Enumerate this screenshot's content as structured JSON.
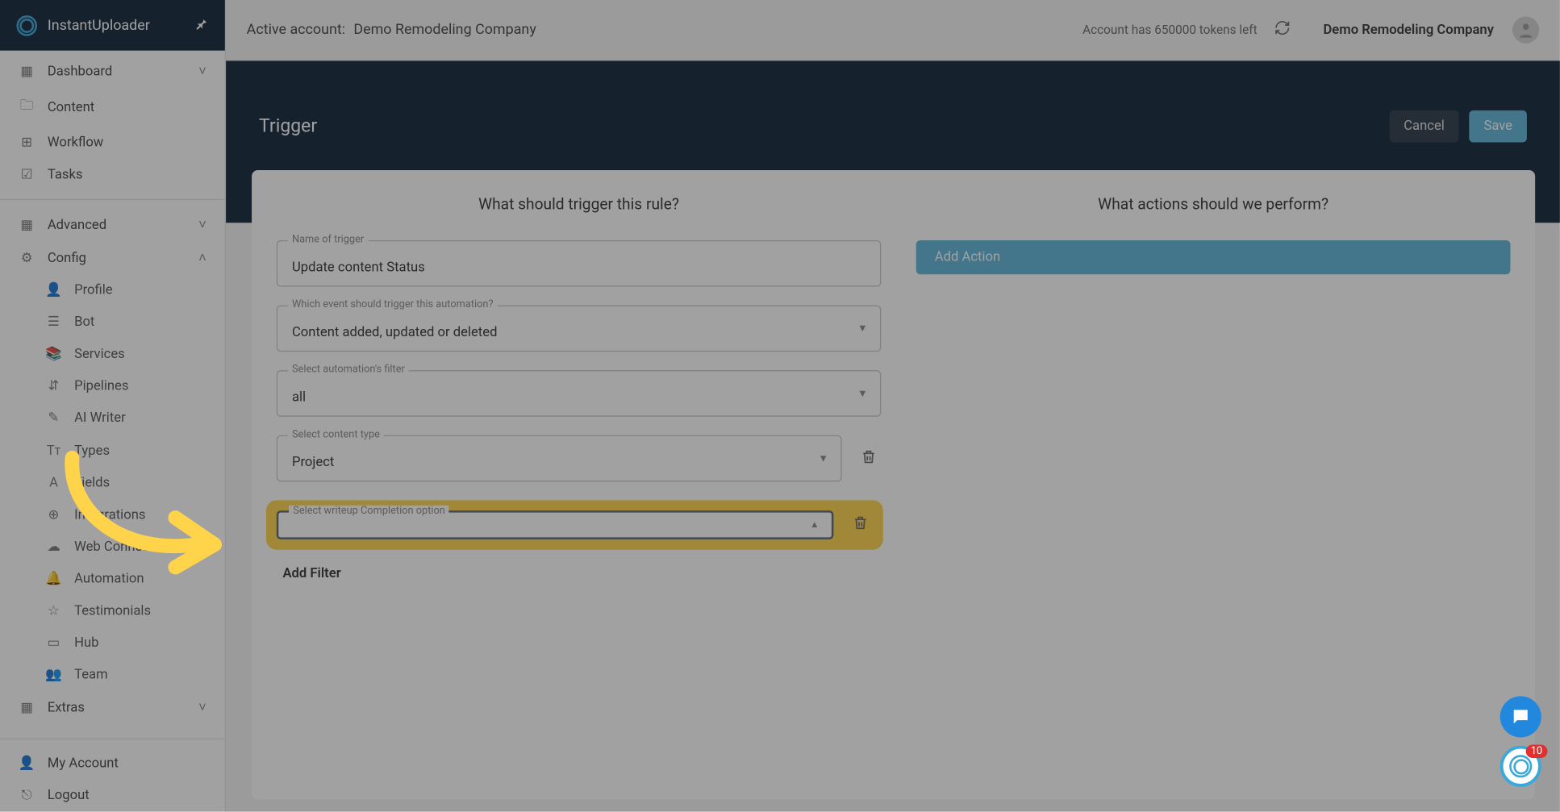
{
  "brand": "InstantUploader",
  "topbar": {
    "active_account_prefix": "Active account:",
    "active_account_name": "Demo Remodeling Company",
    "tokens_text": "Account has 650000 tokens left",
    "company": "Demo Remodeling Company"
  },
  "sidebar": {
    "items": [
      {
        "label": "Dashboard",
        "glyph": "▦",
        "chev": "˅"
      },
      {
        "label": "Content",
        "glyph": "🗀"
      },
      {
        "label": "Workflow",
        "glyph": "⊞"
      },
      {
        "label": "Tasks",
        "glyph": "☑"
      }
    ],
    "group2": [
      {
        "label": "Advanced",
        "glyph": "▦",
        "chev": "˅"
      },
      {
        "label": "Config",
        "glyph": "⚙",
        "chev": "˄"
      }
    ],
    "config_sub": [
      {
        "label": "Profile",
        "glyph": "👤"
      },
      {
        "label": "Bot",
        "glyph": "☰"
      },
      {
        "label": "Services",
        "glyph": "📚"
      },
      {
        "label": "Pipelines",
        "glyph": "⇵"
      },
      {
        "label": "AI Writer",
        "glyph": "✎"
      },
      {
        "label": "Types",
        "glyph": "Tᴛ"
      },
      {
        "label": "Fields",
        "glyph": "A"
      },
      {
        "label": "Integrations",
        "glyph": "⊕"
      },
      {
        "label": "Web Connect",
        "glyph": "☁"
      },
      {
        "label": "Automation",
        "glyph": "🔔"
      },
      {
        "label": "Testimonials",
        "glyph": "☆"
      },
      {
        "label": "Hub",
        "glyph": "▭"
      },
      {
        "label": "Team",
        "glyph": "👥"
      }
    ],
    "extras": {
      "label": "Extras",
      "glyph": "▦",
      "chev": "˅"
    },
    "footer": [
      {
        "label": "My Account",
        "glyph": "👤"
      },
      {
        "label": "Logout",
        "glyph": "⎋"
      }
    ]
  },
  "band": {
    "title": "Trigger",
    "cancel": "Cancel",
    "save": "Save"
  },
  "form": {
    "left_title": "What should trigger this rule?",
    "right_title": "What actions should we perform?",
    "add_action": "Add Action",
    "name_label": "Name of trigger",
    "name_value": "Update content Status",
    "event_label": "Which event should trigger this automation?",
    "event_value": "Content added, updated or deleted",
    "filter_label": "Select automation's filter",
    "filter_value": "all",
    "ctype_label": "Select content type",
    "ctype_value": "Project",
    "writeup_label": "Select writeup Completion option",
    "writeup_value": "",
    "add_filter": "Add Filter"
  },
  "badge": "10"
}
